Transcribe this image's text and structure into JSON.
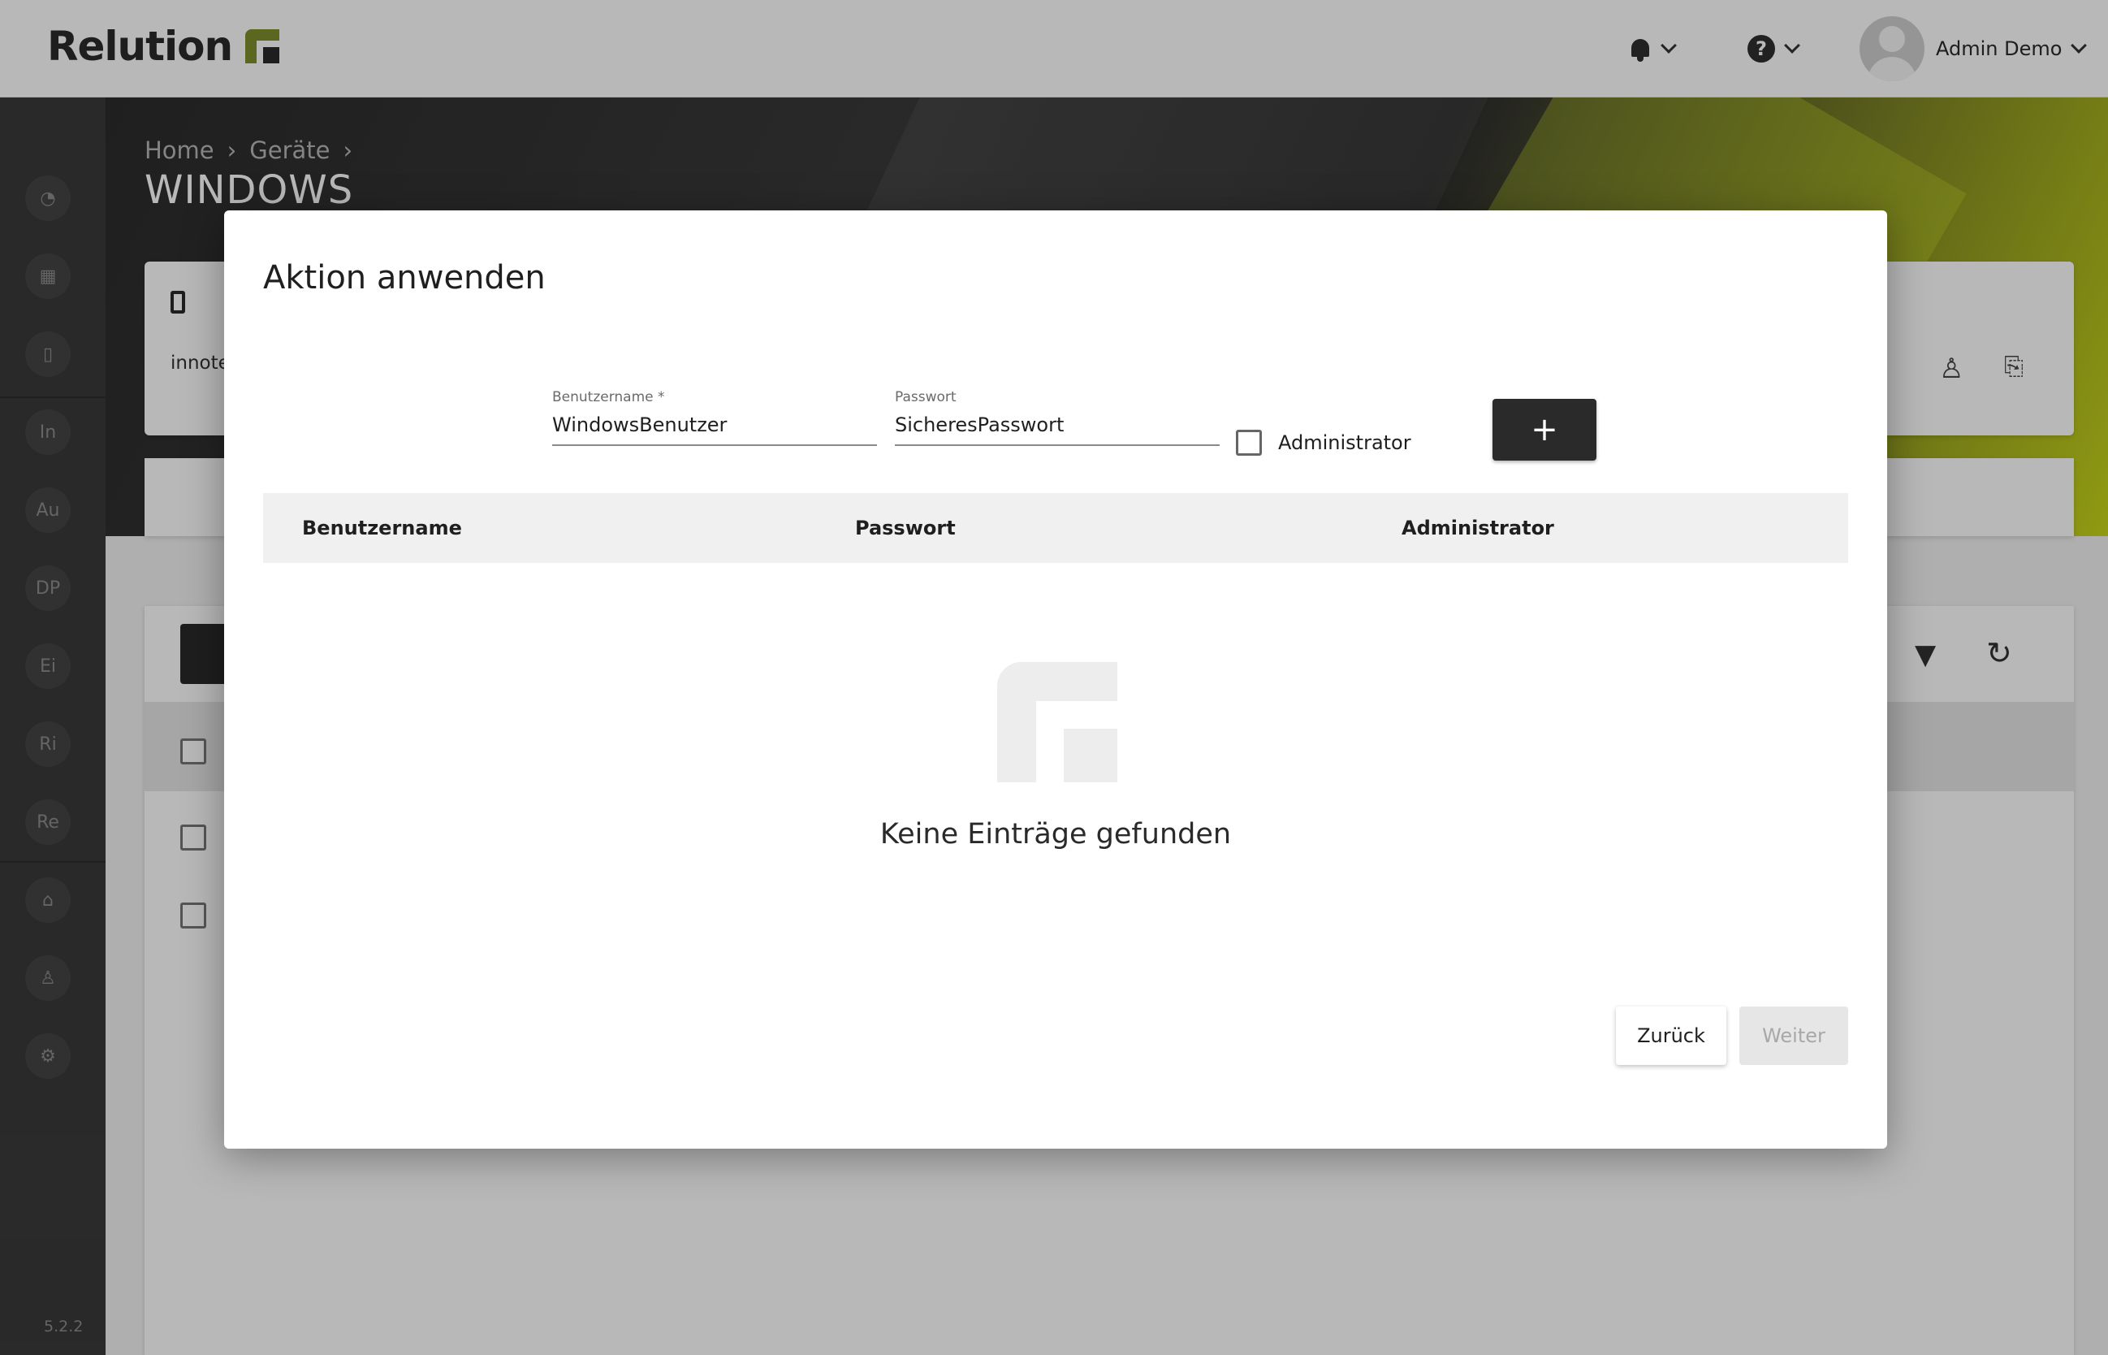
{
  "app": {
    "name": "Relution",
    "version": "5.2.2"
  },
  "header": {
    "user_name": "Admin Demo"
  },
  "breadcrumb": [
    "Home",
    "Geräte"
  ],
  "page_title": "WINDOWS",
  "sidebar": {
    "items": [
      "In",
      "Au",
      "DP",
      "Ei",
      "Ri",
      "Re"
    ]
  },
  "background": {
    "device_card_text": "innote"
  },
  "modal": {
    "title": "Aktion anwenden",
    "username_label": "Benutzername *",
    "username_value": "WindowsBenutzer",
    "password_label": "Passwort",
    "password_value": "SicheresPasswort",
    "admin_checkbox_label": "Administrator",
    "add_button_label": "+",
    "table": {
      "columns": [
        "Benutzername",
        "Passwort",
        "Administrator"
      ],
      "rows": []
    },
    "empty_message": "Keine Einträge gefunden",
    "back_button": "Zurück",
    "next_button": "Weiter"
  },
  "colors": {
    "brand": "#7f8f2c",
    "accent_green": "#c8d61a",
    "dark": "#2a2a2a"
  }
}
